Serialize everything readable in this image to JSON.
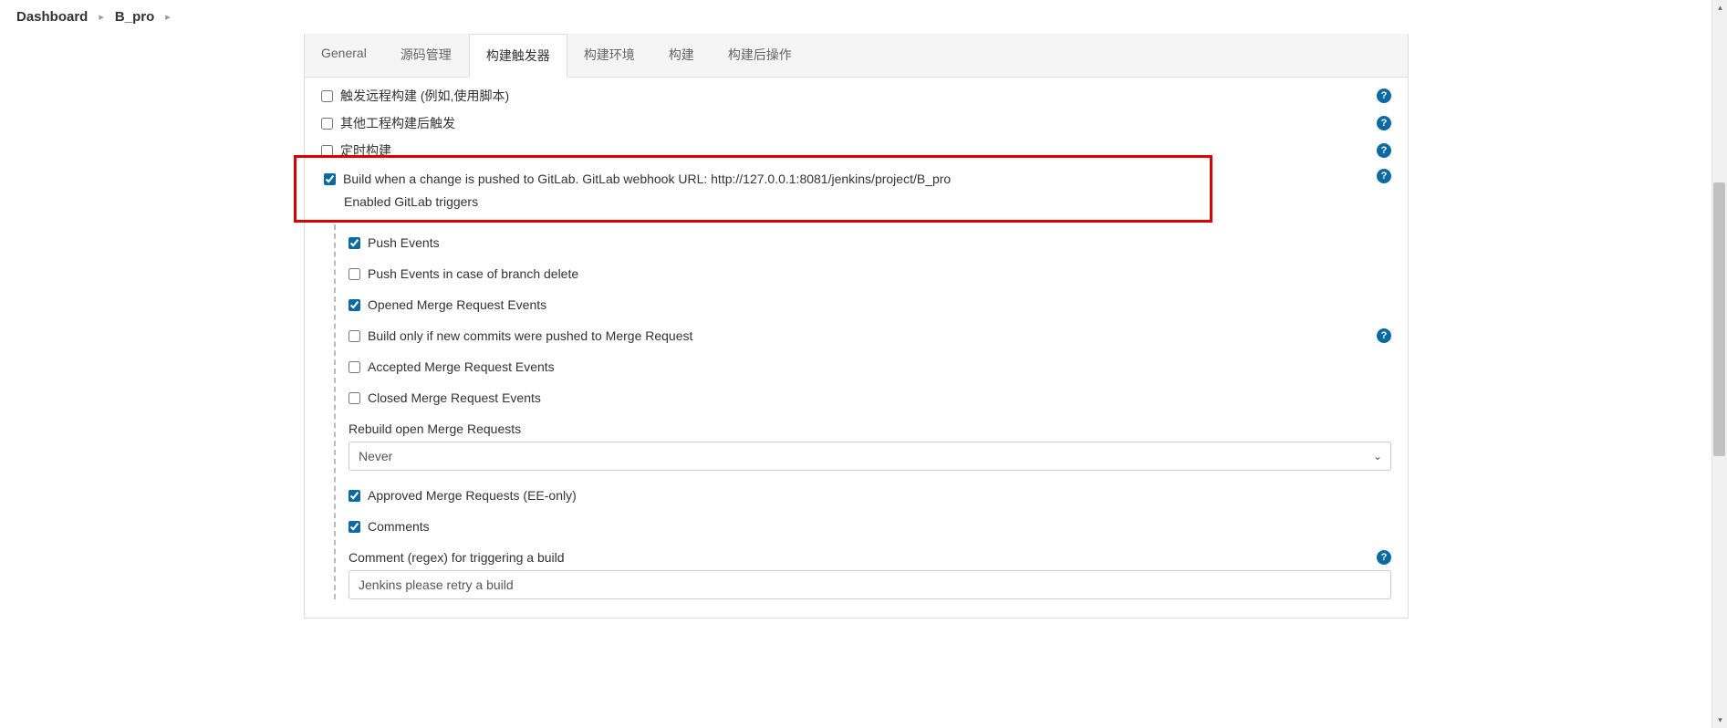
{
  "breadcrumb": {
    "items": [
      "Dashboard",
      "B_pro"
    ]
  },
  "tabs": {
    "items": [
      "General",
      "源码管理",
      "构建触发器",
      "构建环境",
      "构建",
      "构建后操作"
    ],
    "activeIndex": 2
  },
  "triggers": {
    "remote": {
      "label": "触发远程构建 (例如,使用脚本)",
      "checked": false
    },
    "upstream": {
      "label": "其他工程构建后触发",
      "checked": false
    },
    "cron": {
      "label": "定时构建",
      "checked": false
    },
    "gitlab": {
      "label": "Build when a change is pushed to GitLab. GitLab webhook URL: http://127.0.0.1:8081/jenkins/project/B_pro",
      "checked": true,
      "enabledLabel": "Enabled GitLab triggers"
    }
  },
  "gitlabTriggers": {
    "pushEvents": {
      "label": "Push Events",
      "checked": true
    },
    "pushDelete": {
      "label": "Push Events in case of branch delete",
      "checked": false
    },
    "openedMR": {
      "label": "Opened Merge Request Events",
      "checked": true
    },
    "newCommitsMR": {
      "label": "Build only if new commits were pushed to Merge Request",
      "checked": false
    },
    "acceptedMR": {
      "label": "Accepted Merge Request Events",
      "checked": false
    },
    "closedMR": {
      "label": "Closed Merge Request Events",
      "checked": false
    },
    "rebuildLabel": "Rebuild open Merge Requests",
    "rebuildValue": "Never",
    "approvedMR": {
      "label": "Approved Merge Requests (EE-only)",
      "checked": true
    },
    "comments": {
      "label": "Comments",
      "checked": true
    },
    "commentRegexLabel": "Comment (regex) for triggering a build",
    "commentRegexValue": "Jenkins please retry a build"
  }
}
